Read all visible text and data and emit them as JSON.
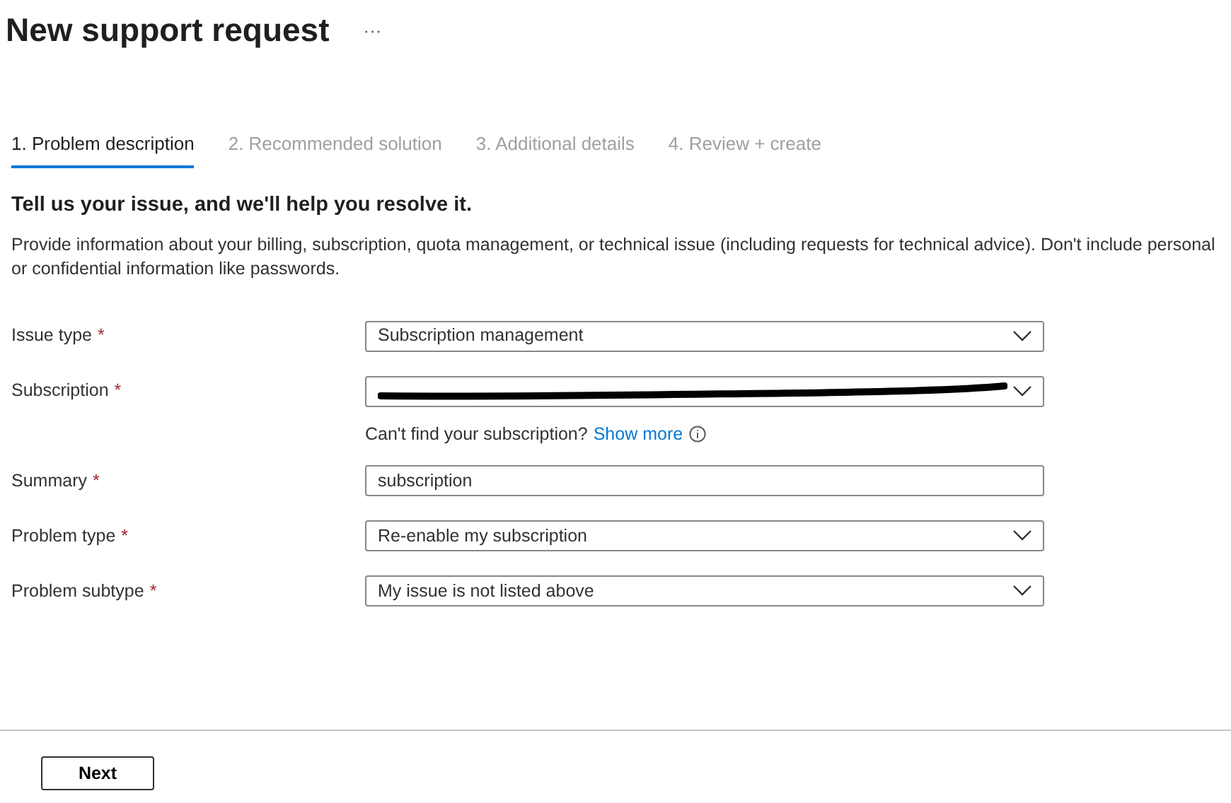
{
  "page": {
    "title": "New support request",
    "more": "···"
  },
  "steps": [
    {
      "label": "1. Problem description",
      "selected": true
    },
    {
      "label": "2. Recommended solution",
      "selected": false
    },
    {
      "label": "3. Additional details",
      "selected": false
    },
    {
      "label": "4. Review + create",
      "selected": false
    }
  ],
  "section": {
    "heading": "Tell us your issue, and we'll help you resolve it.",
    "description": "Provide information about your billing, subscription, quota management, or technical issue (including requests for technical advice). Don't include personal or confidential information like passwords."
  },
  "fields": [
    {
      "label": "Issue type",
      "required_mark": "*",
      "kind": "select",
      "value": "Subscription management"
    },
    {
      "label": "Subscription",
      "required_mark": "*",
      "kind": "select",
      "redacted": true,
      "help": {
        "text": "Can't find your subscription?",
        "link": "Show more"
      }
    },
    {
      "label": "Summary",
      "required_mark": "*",
      "kind": "text",
      "value": "subscription"
    },
    {
      "label": "Problem type",
      "required_mark": "*",
      "kind": "select",
      "value": "Re-enable my subscription"
    },
    {
      "label": "Problem subtype",
      "required_mark": "*",
      "kind": "select",
      "value": "My issue is not listed above"
    }
  ],
  "footer": {
    "buttons": [
      "Next"
    ]
  }
}
